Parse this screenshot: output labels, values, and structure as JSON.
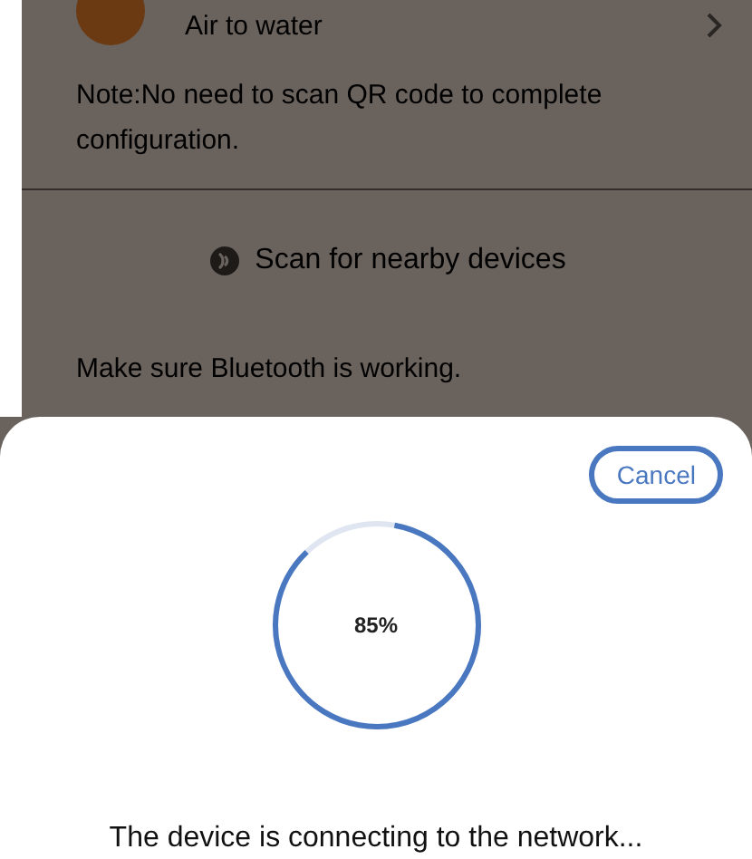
{
  "background_screen": {
    "device": {
      "name": "Air to water"
    },
    "note": "Note:No need to scan QR code to complete configuration.",
    "scan_button": {
      "label": "Scan for nearby devices"
    },
    "hint": "Make sure Bluetooth is working."
  },
  "sheet": {
    "cancel_button": {
      "label": "Cancel"
    },
    "progress": {
      "level": 0.85,
      "reading": "85%"
    },
    "message": "The device is connecting to the network..."
  }
}
